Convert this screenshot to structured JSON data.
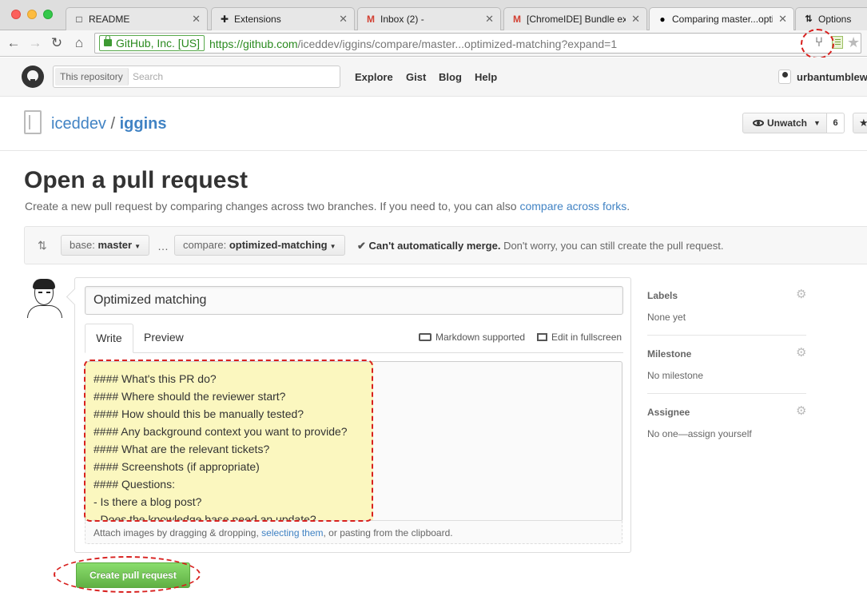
{
  "browser": {
    "tabs": [
      {
        "title": "README",
        "icon": "document-icon"
      },
      {
        "title": "Extensions",
        "icon": "puzzle-icon"
      },
      {
        "title": "Inbox (2) -",
        "icon": "gmail-icon"
      },
      {
        "title": "[ChromeIDE] Bundle exa",
        "icon": "gmail-icon"
      },
      {
        "title": "Comparing master...opti",
        "icon": "github-icon"
      },
      {
        "title": "Options",
        "icon": "pull-request-icon"
      }
    ],
    "ev_badge": "GitHub, Inc. [US]",
    "url_scheme": "https://",
    "url_host": "github.com",
    "url_path": "/iceddev/iggins/compare/master...optimized-matching?expand=1"
  },
  "github_header": {
    "search_scope": "This repository",
    "search_placeholder": "Search",
    "nav": [
      "Explore",
      "Gist",
      "Blog",
      "Help"
    ],
    "username": "urbantumblew"
  },
  "repo": {
    "owner": "iceddev",
    "separator": "/",
    "name": "iggins",
    "watch_label": "Unwatch",
    "watch_count": "6"
  },
  "page": {
    "title": "Open a pull request",
    "description": "Create a new pull request by comparing changes across two branches. If you need to, you can also ",
    "description_link": "compare across forks",
    "description_end": "."
  },
  "range": {
    "base_label": "base:",
    "base_branch": "master",
    "ellipsis": "…",
    "compare_label": "compare:",
    "compare_branch": "optimized-matching",
    "merge_strong": "Can't automatically merge.",
    "merge_text": " Don't worry, you can still create the pull request."
  },
  "composer": {
    "title_value": "Optimized matching",
    "tab_write": "Write",
    "tab_preview": "Preview",
    "markdown_hint": "Markdown supported",
    "fullscreen_hint": "Edit in fullscreen",
    "body_text": "#### What's this PR do?\n#### Where should the reviewer start?\n#### How should this be manually tested?\n#### Any background context you want to provide?\n#### What are the relevant tickets?\n#### Screenshots (if appropriate)\n#### Questions:\n- Is there a blog post?\n- Does the knowledge base need an update?",
    "attach_text": "Attach images by dragging & dropping, ",
    "attach_link": "selecting them",
    "attach_end": ", or pasting from the clipboard.",
    "submit_label": "Create pull request"
  },
  "sidebar": {
    "labels_head": "Labels",
    "labels_val": "None yet",
    "milestone_head": "Milestone",
    "milestone_val": "No milestone",
    "assignee_head": "Assignee",
    "assignee_val": "No one—assign yourself"
  },
  "colors": {
    "link": "#4183c4",
    "highlight": "#fbf7bf",
    "annotation": "#d8201e",
    "create_button": "#60b044"
  }
}
